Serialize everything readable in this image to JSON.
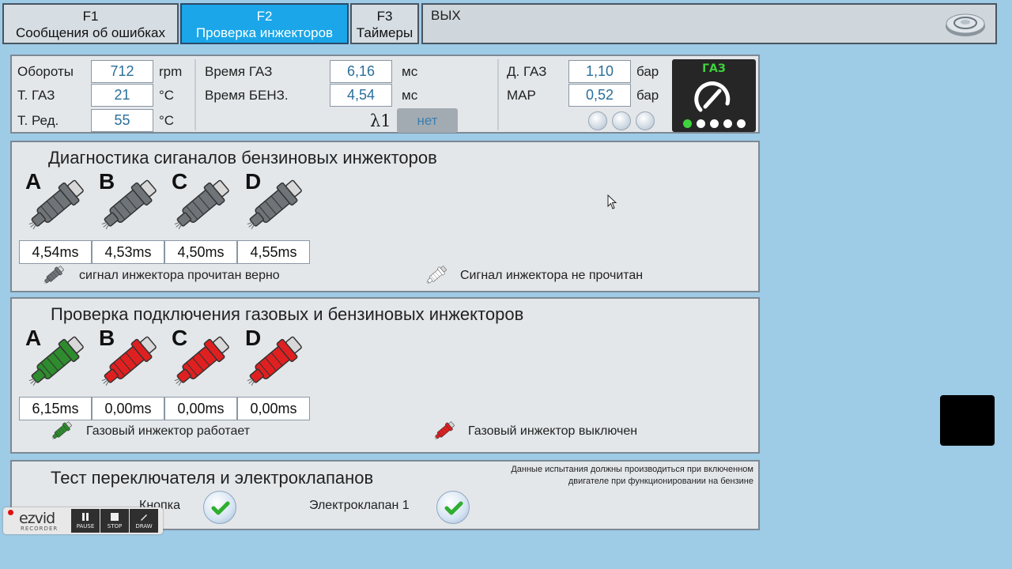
{
  "tabs": [
    {
      "key": "F1",
      "label": "Сообщения об ошибках",
      "active": false
    },
    {
      "key": "F2",
      "label": "Проверка инжекторов",
      "active": true
    },
    {
      "key": "F3",
      "label": "Таймеры",
      "active": false
    }
  ],
  "exit_label": "ВЫХ",
  "params": {
    "rpm": {
      "label": "Обороты",
      "value": "712",
      "unit": "rpm"
    },
    "gas_temp": {
      "label": "Т. ГАЗ",
      "value": "21",
      "unit": "°C"
    },
    "reducer_temp": {
      "label": "Т. Ред.",
      "value": "55",
      "unit": "°C"
    },
    "gas_time": {
      "label": "Время ГАЗ",
      "value": "6,16",
      "unit": "мс"
    },
    "petrol_time": {
      "label": "Время БЕНЗ.",
      "value": "4,54",
      "unit": "мс"
    },
    "lambda_label": "λ1",
    "lambda_value": "нет",
    "gas_pressure": {
      "label": "Д. ГАЗ",
      "value": "1,10",
      "unit": "бар"
    },
    "map": {
      "label": "MAP",
      "value": "0,52",
      "unit": "бар"
    }
  },
  "gas_indicator": {
    "title": "ГАЗ",
    "icon": "gas-gauge-icon",
    "active_dot": 0
  },
  "petrol_section": {
    "title": "Диагностика сиганалов бензиновых инжекторов",
    "injectors": [
      {
        "letter": "A",
        "time": "4,54ms"
      },
      {
        "letter": "B",
        "time": "4,53ms"
      },
      {
        "letter": "C",
        "time": "4,50ms"
      },
      {
        "letter": "D",
        "time": "4,55ms"
      }
    ],
    "legend_ok": "сигнал инжектора прочитан верно",
    "legend_fail": "Сигнал инжектора не прочитан",
    "color_ok": "#6f7478",
    "color_fail": "#ffffff"
  },
  "gas_section": {
    "title": "Проверка подключения газовых и бензиновых инжекторов",
    "injectors": [
      {
        "letter": "A",
        "time": "6,15ms",
        "color": "#2e8b2e"
      },
      {
        "letter": "B",
        "time": "0,00ms",
        "color": "#e02020"
      },
      {
        "letter": "C",
        "time": "0,00ms",
        "color": "#e02020"
      },
      {
        "letter": "D",
        "time": "0,00ms",
        "color": "#e02020"
      }
    ],
    "legend_ok": "Газовый инжектор работает",
    "legend_fail": "Газовый инжектор выключен"
  },
  "switch_section": {
    "title": "Тест переключателя и электроклапанов",
    "note_line1": "Данные испытания должны производиться при включенном",
    "note_line2": "двигателе при функционировании на бензине",
    "button_label": "Кнопка",
    "valve_label": "Электроклапан 1"
  },
  "recorder": {
    "logo": "ezvid",
    "sub": "RECORDER",
    "pause": "PAUSE",
    "stop": "STOP",
    "draw": "DRAW"
  }
}
